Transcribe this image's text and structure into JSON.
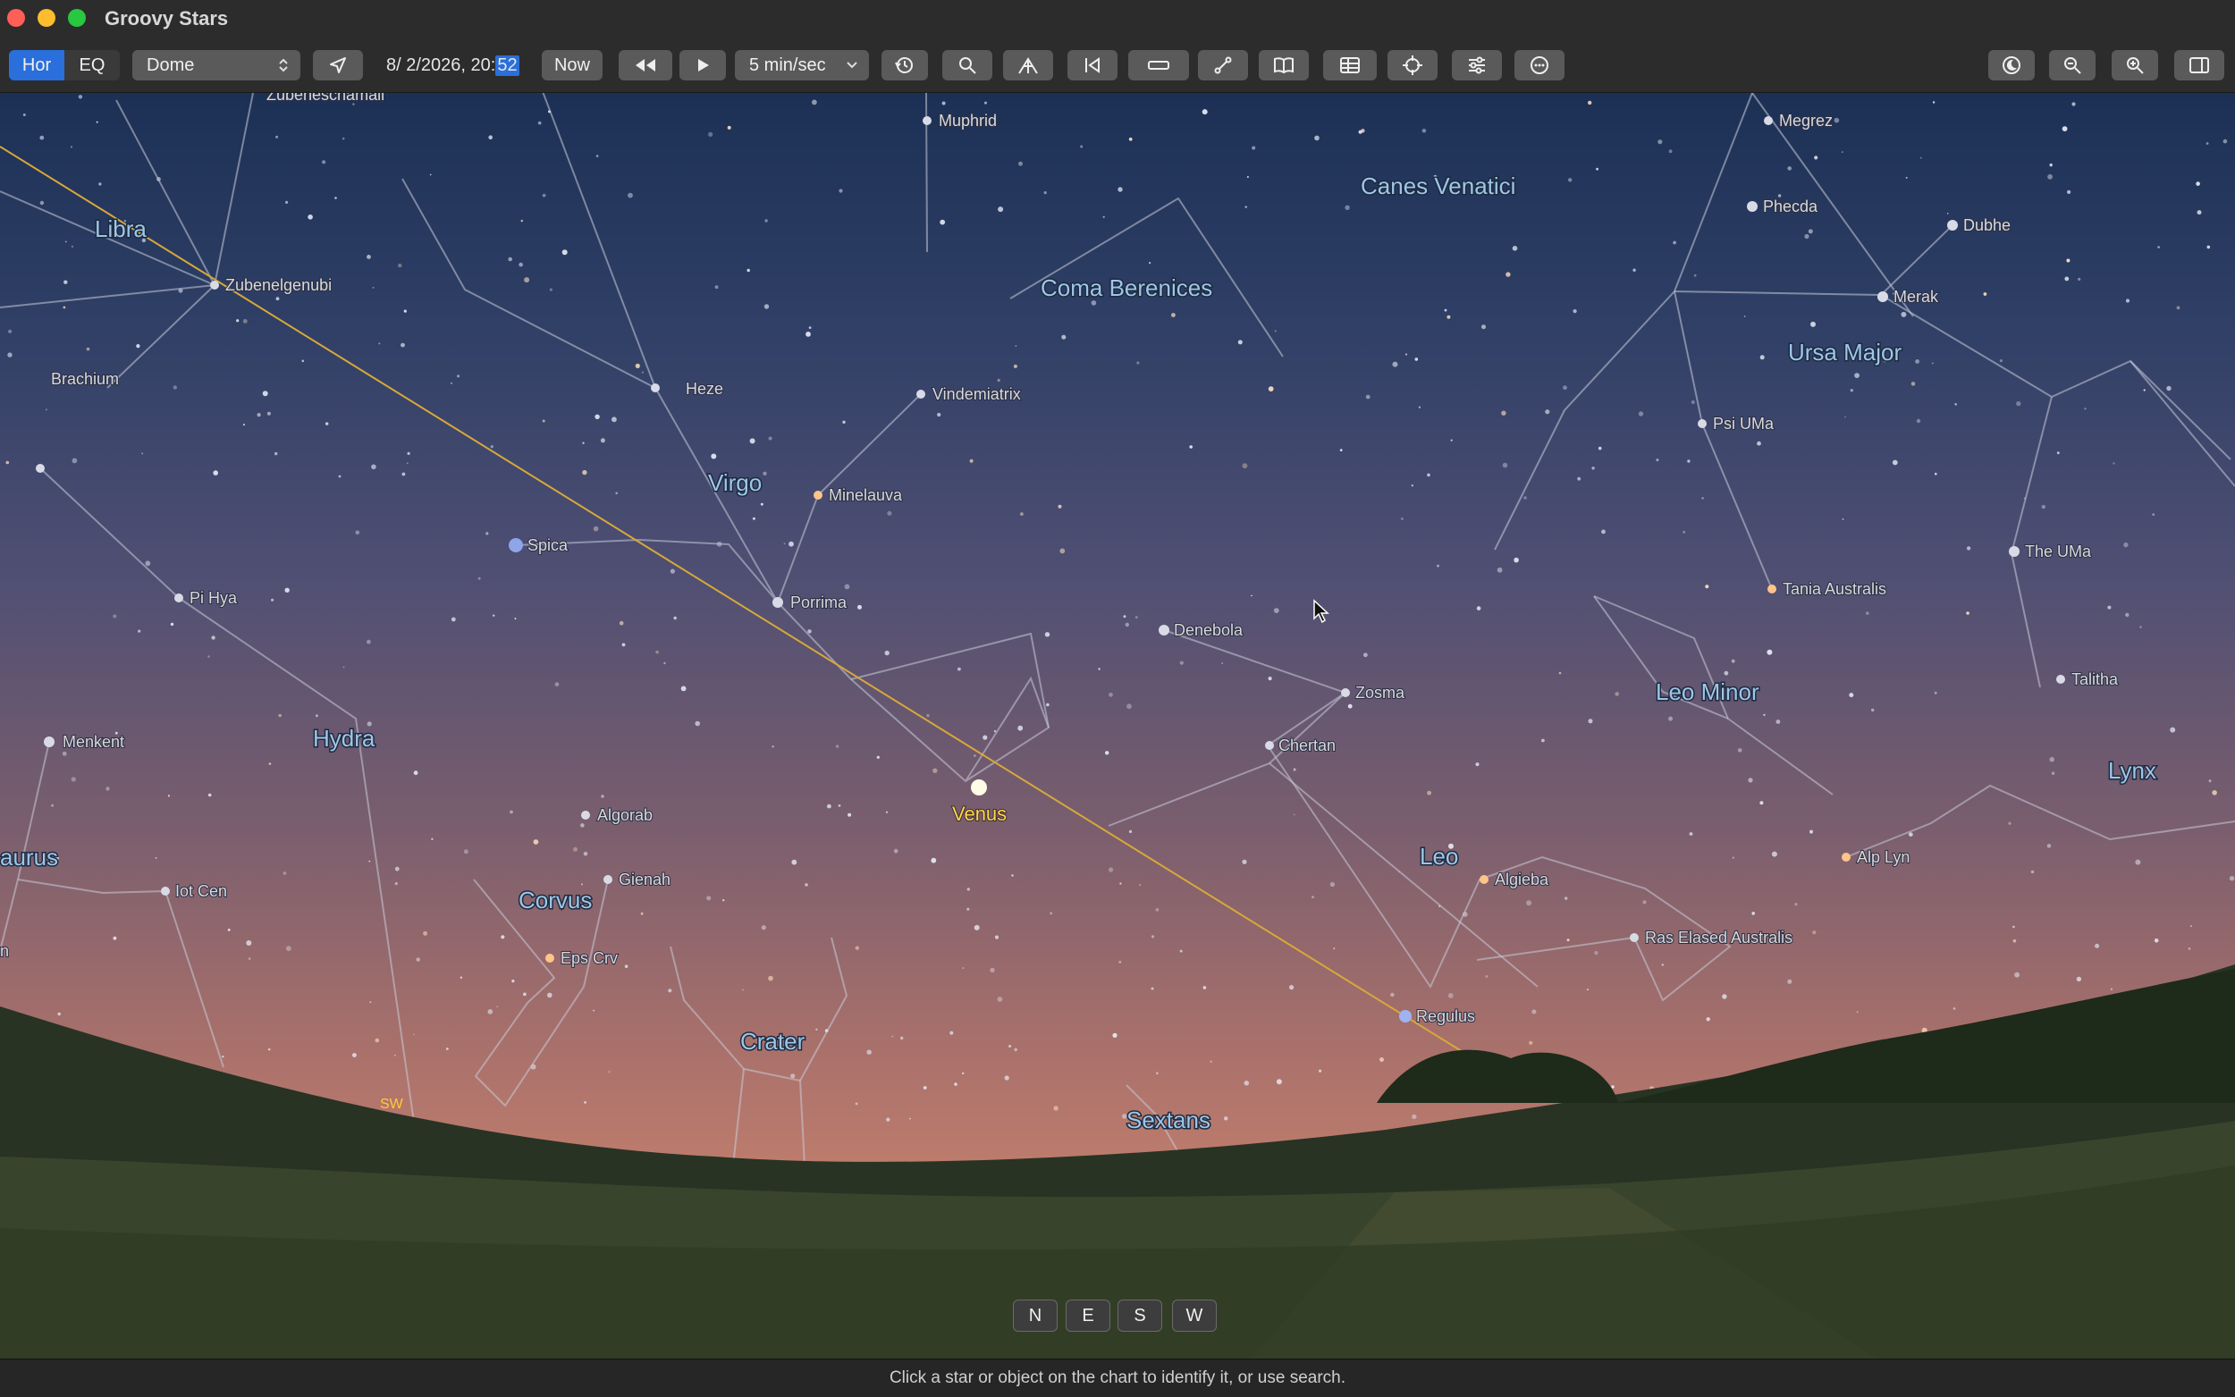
{
  "window": {
    "title": "Groovy Stars"
  },
  "toolbar": {
    "hor_label": "Hor",
    "eq_label": "EQ",
    "view_mode": "Dome",
    "datetime_prefix": "8/  2/2026, 20:",
    "datetime_selected": "52",
    "now_label": "Now",
    "speed": "5 min/sec",
    "icons": [
      "location-arrow-icon",
      "rewind-icon",
      "play-icon",
      "history-icon",
      "search-icon",
      "telescope-icon",
      "flip-icon",
      "ruler-icon",
      "path-icon",
      "book-icon",
      "table-icon",
      "crosshair-icon",
      "sliders-icon",
      "more-icon",
      "night-mode-icon",
      "zoom-out-icon",
      "zoom-in-icon",
      "sidebar-icon"
    ]
  },
  "colors": {
    "accent": "#2a6fdb",
    "ecliptic": "#d6a83a",
    "constellation_lines": "#c9cbd8",
    "constellation_labels": "#9ec6e6",
    "star_labels": "#d9d9d9",
    "planet_label": "#ffd84a"
  },
  "sky": {
    "constellations": [
      {
        "name": "Libra"
      },
      {
        "name": "Virgo"
      },
      {
        "name": "Coma Berenices"
      },
      {
        "name": "Canes Venatici"
      },
      {
        "name": "Ursa Major"
      },
      {
        "name": "Hydra"
      },
      {
        "name": "Corvus"
      },
      {
        "name": "Crater"
      },
      {
        "name": "Sextans"
      },
      {
        "name": "Leo"
      },
      {
        "name": "Leo Minor"
      },
      {
        "name": "Lynx"
      },
      {
        "name": "Centaurus",
        "shown": "aurus"
      }
    ],
    "stars": [
      {
        "name": "Zubeneschamali"
      },
      {
        "name": "Zubenelgenubi"
      },
      {
        "name": "Brachium"
      },
      {
        "name": "Muphrid"
      },
      {
        "name": "Heze"
      },
      {
        "name": "Vindemiatrix"
      },
      {
        "name": "Minelauva"
      },
      {
        "name": "Spica"
      },
      {
        "name": "Porrima"
      },
      {
        "name": "Pi Hya"
      },
      {
        "name": "Menkent"
      },
      {
        "name": "Iot Cen"
      },
      {
        "name": "Algorab"
      },
      {
        "name": "Gienah"
      },
      {
        "name": "Eps Crv"
      },
      {
        "name": "Denebola"
      },
      {
        "name": "Zosma"
      },
      {
        "name": "Chertan"
      },
      {
        "name": "Algieba"
      },
      {
        "name": "Ras Elased Australis"
      },
      {
        "name": "Regulus"
      },
      {
        "name": "Megrez"
      },
      {
        "name": "Phecda"
      },
      {
        "name": "Dubhe"
      },
      {
        "name": "Merak"
      },
      {
        "name": "Psi UMa"
      },
      {
        "name": "Tania Australis"
      },
      {
        "name": "The UMa"
      },
      {
        "name": "Talitha"
      },
      {
        "name": "Alp Lyn"
      }
    ],
    "planet": {
      "name": "Venus"
    },
    "horizon_marker": "SW",
    "edge_fragment": "n"
  },
  "compass": {
    "n": "N",
    "e": "E",
    "s": "S",
    "w": "W"
  },
  "status": {
    "text": "Click a star or object on the chart to identify it, or use search."
  }
}
